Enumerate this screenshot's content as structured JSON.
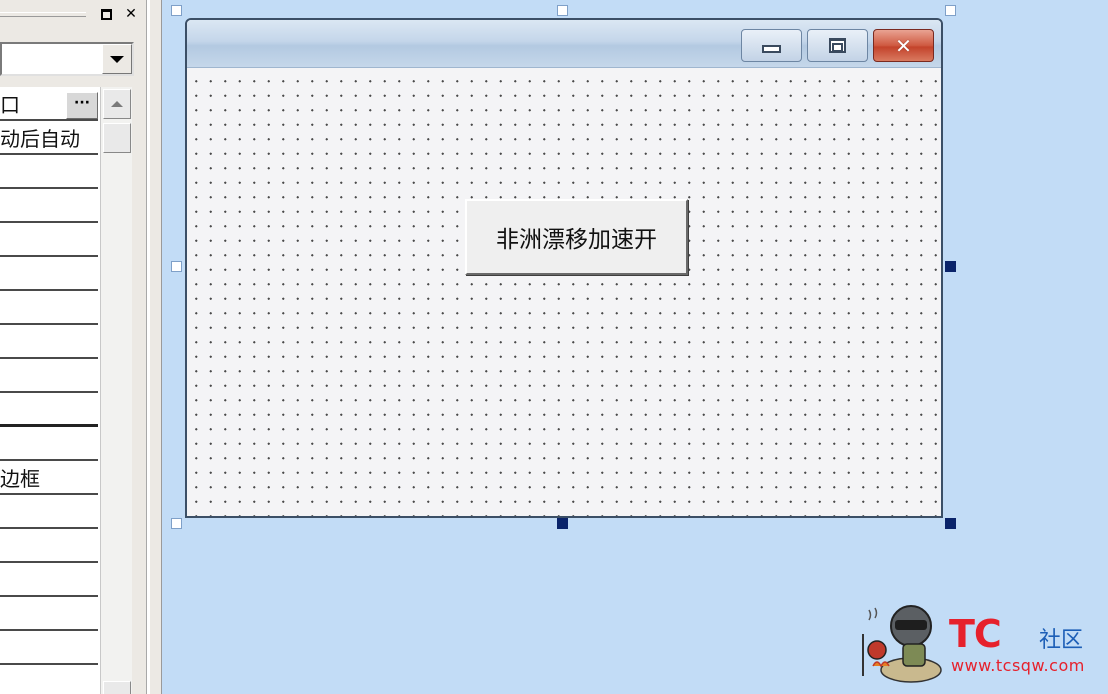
{
  "property_panel": {
    "object_combo_value": "",
    "rows": [
      {
        "text": "口",
        "has_ellipsis": true
      },
      {
        "text": "动后自动"
      },
      {
        "text": ""
      },
      {
        "text": ""
      },
      {
        "text": ""
      },
      {
        "text": ""
      },
      {
        "text": ""
      },
      {
        "text": ""
      },
      {
        "text": ""
      },
      {
        "text": ""
      },
      {
        "text": ""
      },
      {
        "text": "边框"
      },
      {
        "text": ""
      },
      {
        "text": ""
      },
      {
        "text": ""
      },
      {
        "text": ""
      },
      {
        "text": ""
      }
    ],
    "ellipsis_label": "···"
  },
  "form": {
    "title": "",
    "button_label": "非洲漂移加速开"
  },
  "watermark": {
    "logo": "TC",
    "community": "社区",
    "url": "www.tcsqw.com"
  }
}
